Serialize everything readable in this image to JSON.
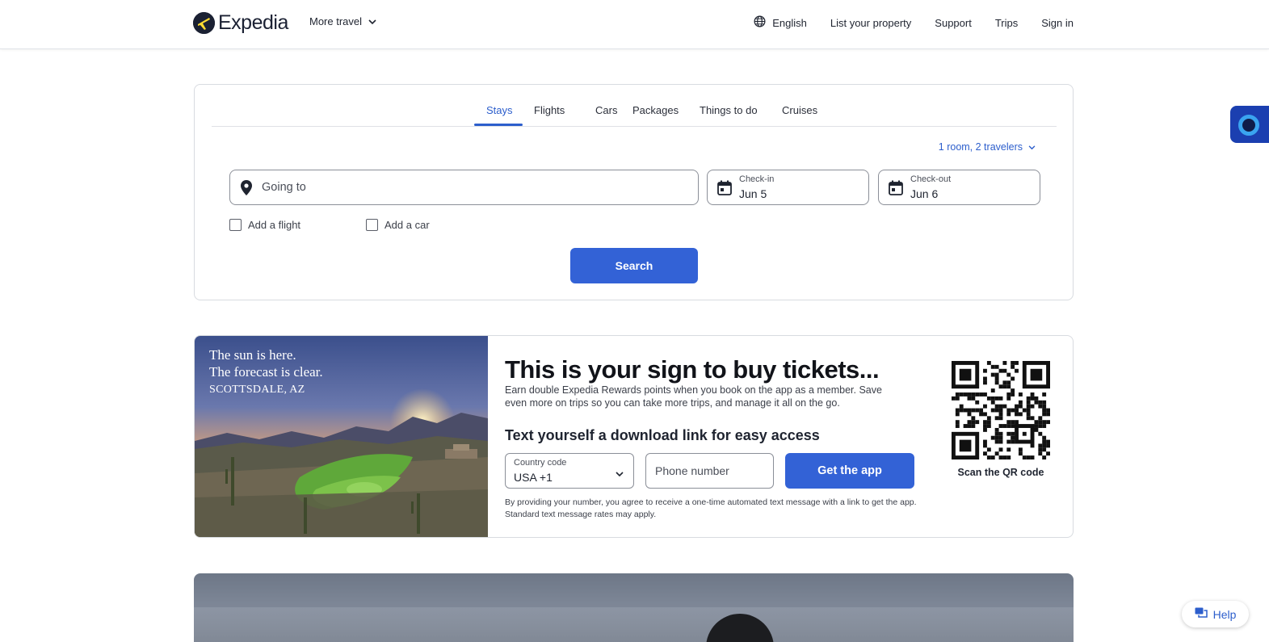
{
  "header": {
    "brand": "Expedia",
    "more_travel": "More travel",
    "nav": {
      "language": "English",
      "list_property": "List your property",
      "support": "Support",
      "trips": "Trips",
      "sign_in": "Sign in"
    }
  },
  "search": {
    "tabs": [
      "Stays",
      "Flights",
      "Cars",
      "Packages",
      "Things to do",
      "Cruises"
    ],
    "active_tab": "Stays",
    "travelers": "1 room, 2 travelers",
    "destination_placeholder": "Going to",
    "checkin": {
      "label": "Check-in",
      "value": "Jun 5"
    },
    "checkout": {
      "label": "Check-out",
      "value": "Jun 6"
    },
    "add_flight": "Add a flight",
    "add_car": "Add a car",
    "search_button": "Search"
  },
  "promo": {
    "image_caption": {
      "line1": "The sun is here.",
      "line2": "The forecast is clear.",
      "place": "SCOTTSDALE, AZ"
    },
    "title": "This is your sign to buy tickets...",
    "description": "Earn double Expedia Rewards points when you book on the app as a member. Save even more on trips so you can take more trips, and manage it all on the go.",
    "subtitle": "Text yourself a download link for easy access",
    "country_code": {
      "label": "Country code",
      "value": "USA +1"
    },
    "phone_placeholder": "Phone number",
    "get_app_button": "Get the app",
    "disclaimer": "By providing your number, you agree to receive a one-time automated text message with a link to get the app. Standard text message rates may apply.",
    "qr_label": "Scan the QR code"
  },
  "help": {
    "label": "Help"
  },
  "colors": {
    "accent": "#3362d6",
    "link": "#2c5ecc",
    "brand_dark": "#1b2133",
    "side_widget": "#1b3fb0"
  },
  "icons": {
    "logo": "expedia-plane-icon",
    "more_travel": "chevron-down-icon",
    "language": "globe-icon",
    "destination": "map-pin-icon",
    "date": "calendar-icon",
    "help": "chat-icon"
  }
}
